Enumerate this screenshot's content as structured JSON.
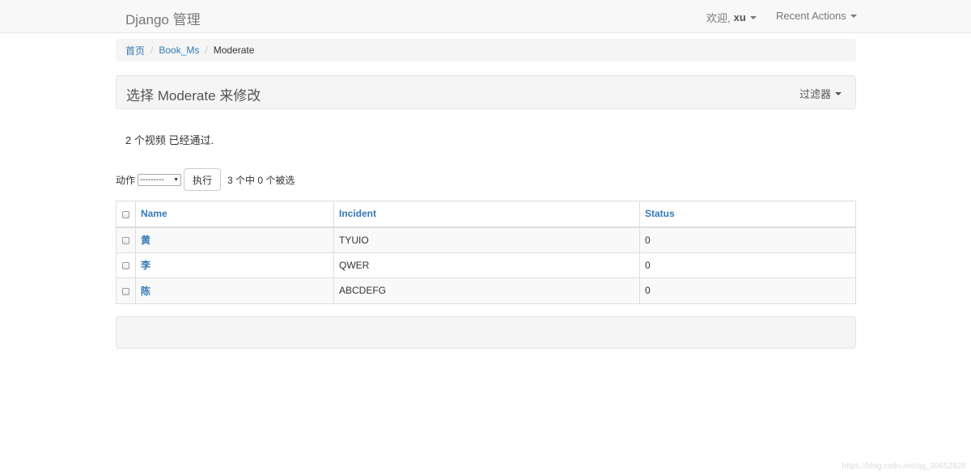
{
  "navbar": {
    "brand": "Django 管理",
    "welcome_prefix": "欢迎,",
    "username": "xu",
    "recent_actions": "Recent Actions"
  },
  "breadcrumb": {
    "home": "首页",
    "app": "Book_Ms",
    "current": "Moderate",
    "separator": "/"
  },
  "page": {
    "title": "选择 Moderate 来修改",
    "filter_label": "过滤器"
  },
  "message": "2 个视频 已经通过.",
  "actions": {
    "label": "动作",
    "select_value": "---------",
    "run_button": "执行",
    "counter": "3 个中 0 个被选"
  },
  "table": {
    "headers": [
      "Name",
      "Incident",
      "Status"
    ],
    "rows": [
      {
        "name": "黄",
        "incident": "TYUIO",
        "status": "0"
      },
      {
        "name": "李",
        "incident": "QWER",
        "status": "0"
      },
      {
        "name": "陈",
        "incident": "ABCDEFG",
        "status": "0"
      }
    ]
  },
  "watermark": "https://blog.csdn.net/qq_39652828",
  "colors": {
    "link": "#337ab7",
    "panel": "#f5f5f5"
  }
}
